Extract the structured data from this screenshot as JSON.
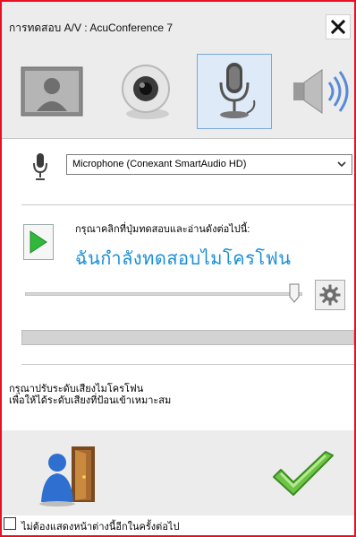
{
  "window": {
    "title": "การทดสอบ A/V : AcuConference 7"
  },
  "tabs": [
    {
      "name": "video",
      "icon": "person-portrait-icon",
      "active": false
    },
    {
      "name": "webcam",
      "icon": "webcam-icon",
      "active": false
    },
    {
      "name": "microphone",
      "icon": "microphone-icon",
      "active": true
    },
    {
      "name": "speaker",
      "icon": "speaker-icon",
      "active": false
    }
  ],
  "microphone": {
    "device": "Microphone (Conexant SmartAudio HD)",
    "prompt": "กรุณาคลิกที่ปุ่มทดสอบและอ่านดังต่อไปนี้:",
    "test_phrase": "ฉันกำลังทดสอบไมโครโฟน",
    "slider_level": 0.97,
    "input_level": 0.0,
    "instruction_line1": "กรุณาปรับระดับเสียงไมโครโฟน",
    "instruction_line2": "เพื่อให้ได้ระดับเสียงที่ป้อนเข้าเหมาะสม"
  },
  "footer": {
    "dont_show_label": "ไม่ต้องแสดงหน้าต่างนี้อีกในครั้งต่อไป",
    "checked": false
  },
  "colors": {
    "window_border": "#e81123",
    "phrase": "#1a8ed8",
    "accent_green": "#2fb83b"
  }
}
